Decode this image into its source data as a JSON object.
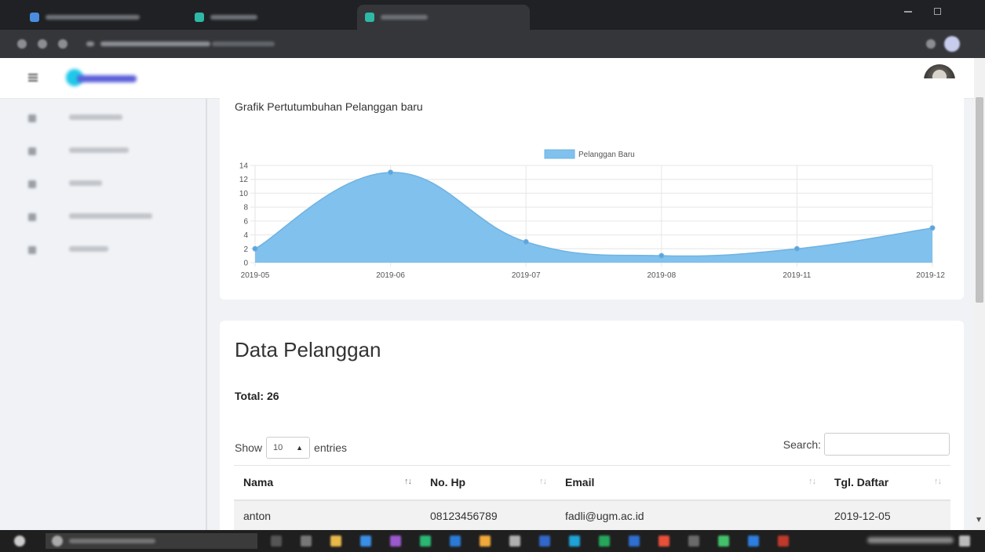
{
  "colors": {
    "chart_fill": "#80c1ed",
    "chart_line": "#6fb3e3",
    "point": "#5ea4d8",
    "grid": "#e6e6e6",
    "card_bg": "#ffffff",
    "page_bg": "#f0f2f5"
  },
  "header": {
    "menu_icon": "hamburger-icon",
    "logo": "app-logo"
  },
  "chart_card": {
    "title": "Grafik Pertutumbuhan Pelanggan baru"
  },
  "chart_data": {
    "type": "area",
    "title": "Grafik Pertutumbuhan Pelanggan baru",
    "categories": [
      "2019-05",
      "2019-06",
      "2019-07",
      "2019-08",
      "2019-11",
      "2019-12"
    ],
    "series": [
      {
        "name": "Pelanggan Baru",
        "values": [
          2,
          13,
          3,
          1,
          2,
          5
        ]
      }
    ],
    "yticks": [
      "0",
      "2",
      "4",
      "6",
      "8",
      "10",
      "12",
      "14"
    ],
    "ylim": [
      0,
      14
    ],
    "xlabel": "",
    "ylabel": "",
    "legend": "top-center",
    "grid": true
  },
  "table_card": {
    "title": "Data Pelanggan",
    "total": "Total: 26",
    "show_label": "Show",
    "entries_value": "10",
    "entries_label": "entries",
    "search_label": "Search:",
    "search_value": "",
    "columns": [
      "Nama",
      "No. Hp",
      "Email",
      "Tgl. Daftar"
    ],
    "rows": [
      [
        "anton",
        "08123456789",
        "fadli@ugm.ac.id",
        "2019-12-05"
      ]
    ]
  }
}
